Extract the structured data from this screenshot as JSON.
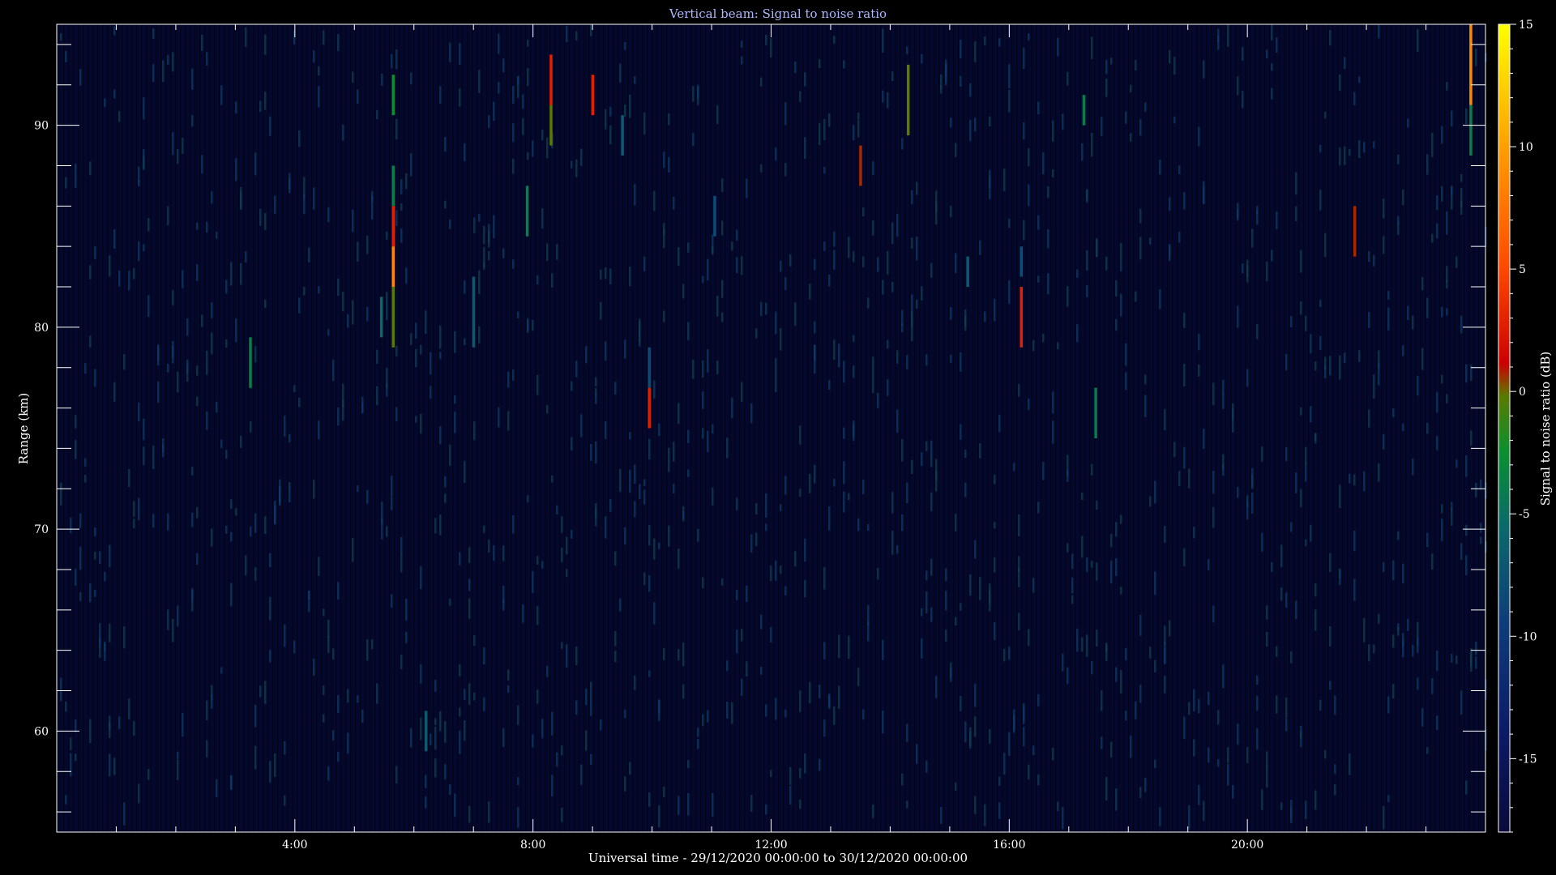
{
  "chart_data": {
    "type": "heatmap",
    "title": "Vertical beam: Signal to noise ratio",
    "xlabel": "Universal time - 29/12/2020 00:00:00 to 30/12/2020 00:00:00",
    "ylabel": "Range (km)",
    "xlim_hours": [
      0,
      24
    ],
    "ylim": [
      55,
      95
    ],
    "x_ticks": [
      {
        "value": 4,
        "label": "4:00"
      },
      {
        "value": 8,
        "label": "8:00"
      },
      {
        "value": 12,
        "label": "12:00"
      },
      {
        "value": 16,
        "label": "16:00"
      },
      {
        "value": 20,
        "label": "20:00"
      }
    ],
    "y_ticks": [
      60,
      70,
      80,
      90
    ],
    "colorbar": {
      "label": "Signal to noise ratio (dB)",
      "range": [
        -18,
        15
      ],
      "ticks": [
        -15,
        -10,
        -5,
        0,
        5,
        10,
        15
      ]
    },
    "background_level_db": -16,
    "grid": false,
    "echoes": [
      {
        "t": 3.25,
        "r0": 77,
        "r1": 79.5,
        "snr": -6
      },
      {
        "t": 5.45,
        "r0": 79.5,
        "r1": 81.5,
        "snr": -7
      },
      {
        "t": 5.65,
        "r0": 90.5,
        "r1": 92.5,
        "snr": -5
      },
      {
        "t": 5.65,
        "r0": 86,
        "r1": 88,
        "snr": -6
      },
      {
        "t": 5.65,
        "r0": 84,
        "r1": 86,
        "snr": 0
      },
      {
        "t": 5.65,
        "r0": 82,
        "r1": 84,
        "snr": 6
      },
      {
        "t": 5.65,
        "r0": 79,
        "r1": 82,
        "snr": -3
      },
      {
        "t": 6.2,
        "r0": 59,
        "r1": 61,
        "snr": -8
      },
      {
        "t": 7.0,
        "r0": 79,
        "r1": 82.5,
        "snr": -8
      },
      {
        "t": 7.9,
        "r0": 84.5,
        "r1": 87,
        "snr": -6
      },
      {
        "t": 8.3,
        "r0": 91,
        "r1": 93.5,
        "snr": 0
      },
      {
        "t": 8.3,
        "r0": 89,
        "r1": 91,
        "snr": -3
      },
      {
        "t": 9.0,
        "r0": 90.5,
        "r1": 92.5,
        "snr": 0
      },
      {
        "t": 9.5,
        "r0": 88.5,
        "r1": 90.5,
        "snr": -8
      },
      {
        "t": 9.95,
        "r0": 75,
        "r1": 77,
        "snr": 0
      },
      {
        "t": 9.95,
        "r0": 77,
        "r1": 79,
        "snr": -9
      },
      {
        "t": 11.05,
        "r0": 84.5,
        "r1": 86.5,
        "snr": -9
      },
      {
        "t": 13.5,
        "r0": 87,
        "r1": 89,
        "snr": -2
      },
      {
        "t": 14.3,
        "r0": 89.5,
        "r1": 93,
        "snr": -3
      },
      {
        "t": 15.3,
        "r0": 82,
        "r1": 83.5,
        "snr": -8
      },
      {
        "t": 16.2,
        "r0": 79,
        "r1": 82,
        "snr": 0
      },
      {
        "t": 16.2,
        "r0": 82.5,
        "r1": 84,
        "snr": -9
      },
      {
        "t": 17.25,
        "r0": 90,
        "r1": 91.5,
        "snr": -6
      },
      {
        "t": 17.45,
        "r0": 74.5,
        "r1": 77,
        "snr": -6
      },
      {
        "t": 21.8,
        "r0": 83.5,
        "r1": 86,
        "snr": -2
      },
      {
        "t": 23.75,
        "r0": 91,
        "r1": 95,
        "snr": 6
      },
      {
        "t": 23.75,
        "r0": 88.5,
        "r1": 91,
        "snr": -6
      }
    ]
  }
}
